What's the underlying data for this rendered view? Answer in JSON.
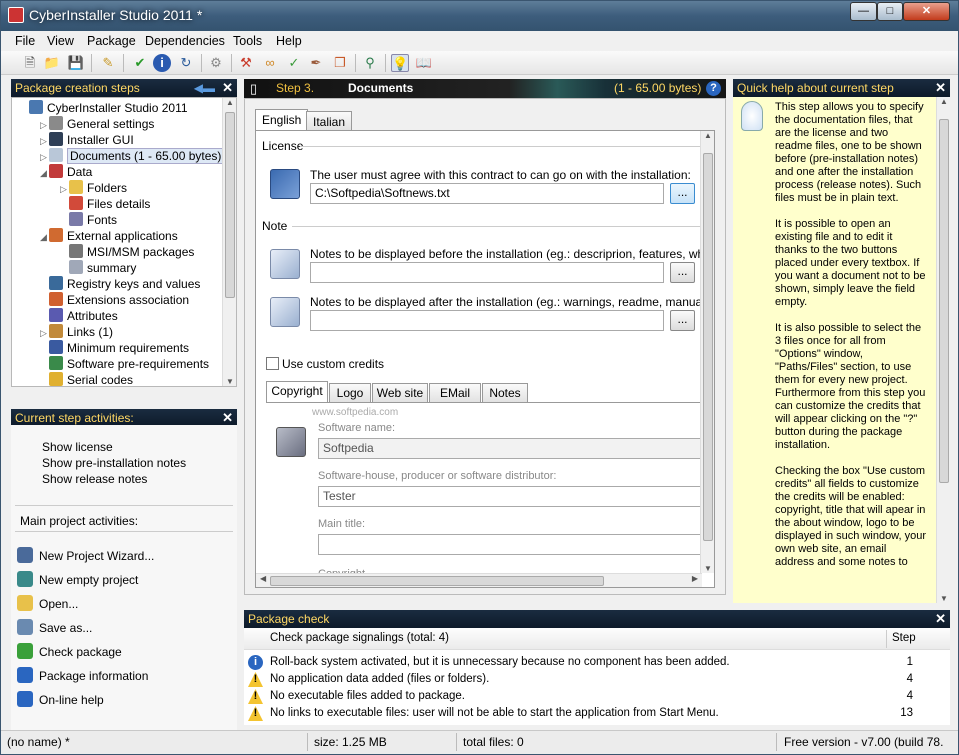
{
  "window": {
    "title": "CyberInstaller Studio 2011 *"
  },
  "menu": [
    "File",
    "View",
    "Package",
    "Dependencies",
    "Tools",
    "Help"
  ],
  "left_panel": {
    "header": "Package creation steps",
    "tree": [
      {
        "label": "CyberInstaller Studio 2011",
        "icon": "computer-icon",
        "color": "#4a78b0"
      },
      {
        "label": "General settings",
        "icon": "settings-icon",
        "color": "#8a8a8a"
      },
      {
        "label": "Installer GUI",
        "icon": "monitor-icon",
        "color": "#2f3f56"
      },
      {
        "label": "Documents (1 - 65.00 bytes)",
        "icon": "documents-icon",
        "color": "#b9c7d8"
      },
      {
        "label": "Data",
        "icon": "data-icon",
        "color": "#c23a3a"
      },
      {
        "label": "Folders",
        "icon": "folder-icon",
        "color": "#e8c14a"
      },
      {
        "label": "Files details",
        "icon": "files-icon",
        "color": "#d24a3a"
      },
      {
        "label": "Fonts",
        "icon": "fonts-icon",
        "color": "#7a7aa8"
      },
      {
        "label": "External applications",
        "icon": "apps-icon",
        "color": "#d06a30"
      },
      {
        "label": "MSI/MSM packages",
        "icon": "msi-icon",
        "color": "#777"
      },
      {
        "label": "summary",
        "icon": "summary-icon",
        "color": "#a0a8b8"
      },
      {
        "label": "Registry keys and values",
        "icon": "registry-icon",
        "color": "#3a6a9a"
      },
      {
        "label": "Extensions association",
        "icon": "extensions-icon",
        "color": "#d06030"
      },
      {
        "label": "Attributes",
        "icon": "attributes-icon",
        "color": "#5a5ab0"
      },
      {
        "label": "Links (1)",
        "icon": "links-icon",
        "color": "#c28a3a"
      },
      {
        "label": "Minimum requirements",
        "icon": "requirements-icon",
        "color": "#3a5aa0"
      },
      {
        "label": "Software pre-requirements",
        "icon": "prereq-icon",
        "color": "#3a8a4a"
      },
      {
        "label": "Serial codes",
        "icon": "key-icon",
        "color": "#e0b030"
      }
    ]
  },
  "step_activities": {
    "header": "Current step activities:",
    "items": [
      "Show license",
      "Show pre-installation notes",
      "Show release notes"
    ]
  },
  "main_activities": {
    "header": "Main project activities:",
    "items": [
      {
        "label": "New Project Wizard...",
        "icon": "wizard-icon",
        "color": "#4a6a9a"
      },
      {
        "label": "New empty project",
        "icon": "new-project-icon",
        "color": "#3a8a8a"
      },
      {
        "label": "Open...",
        "icon": "open-folder-icon",
        "color": "#e8c14a"
      },
      {
        "label": "Save as...",
        "icon": "save-icon",
        "color": "#6a8ab0"
      },
      {
        "label": "Check package",
        "icon": "checkmark-icon",
        "color": "#3aa03a"
      },
      {
        "label": "Package information",
        "icon": "info-icon",
        "color": "#2a66c0"
      },
      {
        "label": "On-line help",
        "icon": "help-icon",
        "color": "#2a66c0"
      }
    ]
  },
  "step": {
    "number": "Step 3.",
    "name": "Documents",
    "info": "(1 - 65.00 bytes)"
  },
  "tabs": [
    "English",
    "Italian"
  ],
  "license": {
    "group": "License",
    "label": "The user must agree with this contract to can go on with the installation:",
    "value": "C:\\Softpedia\\Softnews.txt",
    "browse": "..."
  },
  "note": {
    "group": "Note",
    "before_label": "Notes to be displayed before the installation (eg.: descriprion, features, wha",
    "before_value": "",
    "after_label": "Notes to be displayed after the installation (eg.: warnings, readme, manual,",
    "after_value": "",
    "browse": "..."
  },
  "credits": {
    "checkbox_label": "Use custom credits",
    "checked": false,
    "tabs": [
      "Copyright",
      "Logo",
      "Web site",
      "EMail",
      "Notes"
    ],
    "software_name_label": "Software name:",
    "software_name": "Softpedia",
    "house_label": "Software-house, producer or software distributor:",
    "house": "Tester",
    "main_title_label": "Main title:",
    "main_title": "",
    "copyright_label": "Copyright"
  },
  "quick_help": {
    "header": "Quick help about current step",
    "text": "This step allows you to specify the documentation files, that are the license and two readme files, one to be shown before (pre-installation notes) and one after the installation process (release notes). Such files must be in plain text.\n\nIt is possible to open an existing file and to edit it thanks to the two buttons placed under every textbox. If you want a document not to be shown, simply leave the field empty.\n\nIt is also possible to select the 3 files once for all from \"Options\" window, \"Paths/Files\" section, to use them for every new project. Furthermore from this step you can customize the credits that will appear clicking on the \"?\" button during the package installation.\n\nChecking the box \"Use custom credits\" all fields to customize the credits will be enabled: copyright, title that will apear in the about window, logo to be displayed in such window, your own web site, an email address and some notes to"
  },
  "package_check": {
    "header": "Package check",
    "col_signals": "Check package signalings (total: 4)",
    "col_step": "Step",
    "rows": [
      {
        "type": "info",
        "text": "Roll-back system activated, but it is unnecessary because no component has been added.",
        "step": "1"
      },
      {
        "type": "warning",
        "text": "No application data added (files or folders).",
        "step": "4"
      },
      {
        "type": "warning",
        "text": "No executable files added to package.",
        "step": "4"
      },
      {
        "type": "warning",
        "text": "No links to executable files: user will not be able to start the application from Start Menu.",
        "step": "13"
      }
    ]
  },
  "status": {
    "project": "(no name) *",
    "size": "size: 1.25 MB",
    "files": "total files: 0",
    "version": "Free version - v7.00 (build 78."
  },
  "watermark": "www.softpedia.com"
}
